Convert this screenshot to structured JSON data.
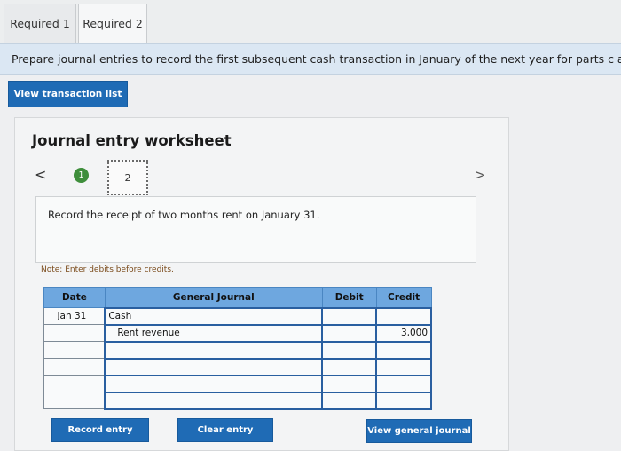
{
  "tabs": [
    {
      "label": "Required 1"
    },
    {
      "label": "Required 2"
    }
  ],
  "instruction": "Prepare journal entries to record the first subsequent cash transaction in January of the next year for parts c and e.",
  "view_transaction_list": "View transaction list",
  "worksheet": {
    "title": "Journal entry worksheet",
    "steps": [
      "1",
      "2"
    ],
    "prev_icon": "<",
    "next_icon": ">",
    "description": "Record the receipt of two months rent on January 31.",
    "note": "Note: Enter debits before credits."
  },
  "journal": {
    "headers": {
      "date": "Date",
      "account": "General Journal",
      "debit": "Debit",
      "credit": "Credit"
    },
    "rows": [
      {
        "date": "Jan 31",
        "account": "Cash",
        "debit": "",
        "credit": ""
      },
      {
        "date": "",
        "account": "Rent revenue",
        "debit": "",
        "credit": "3,000"
      },
      {
        "date": "",
        "account": "",
        "debit": "",
        "credit": ""
      },
      {
        "date": "",
        "account": "",
        "debit": "",
        "credit": ""
      },
      {
        "date": "",
        "account": "",
        "debit": "",
        "credit": ""
      },
      {
        "date": "",
        "account": "",
        "debit": "",
        "credit": ""
      }
    ]
  },
  "buttons": {
    "record": "Record entry",
    "clear": "Clear entry",
    "view_general_journal": "View general journal"
  }
}
